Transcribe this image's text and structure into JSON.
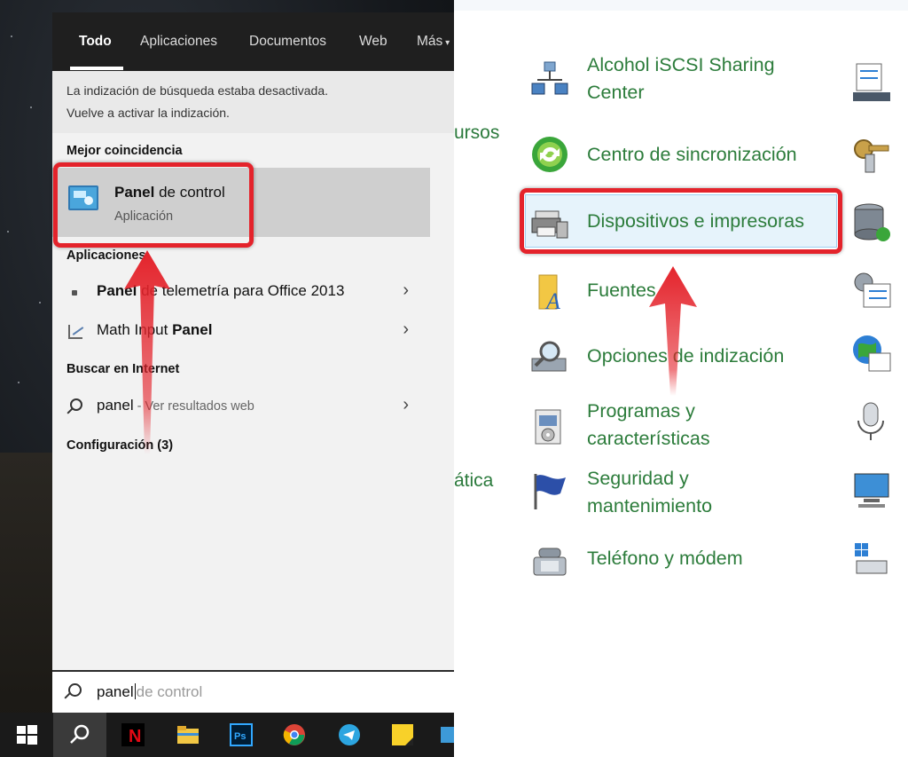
{
  "start_search": {
    "tabs": [
      "Todo",
      "Aplicaciones",
      "Documentos",
      "Web",
      "Más"
    ],
    "notice": {
      "line1": "La indización de búsqueda estaba desactivada.",
      "line2": "Vuelve a activar la indización."
    },
    "best_match_header": "Mejor coincidencia",
    "best_match": {
      "title_bold": "Panel",
      "title_rest": " de control",
      "subtitle": "Aplicación"
    },
    "apps_header": "Aplicaciones",
    "apps": [
      {
        "bold": "Panel",
        "rest": " de telemetría para Office 2013"
      },
      {
        "pre": "Math Input ",
        "bold": "Panel"
      }
    ],
    "web_header": "Buscar en Internet",
    "web_item": {
      "query": "panel",
      "suffix": " - Ver resultados web"
    },
    "settings_header": "Configuración (3)",
    "search_box": {
      "typed": "panel",
      "ghost": "de control"
    }
  },
  "taskbar": {
    "items": [
      "start-icon",
      "search-icon",
      "netflix-icon",
      "file-explorer-icon",
      "photoshop-icon",
      "chrome-icon",
      "telegram-icon",
      "sticky-notes-icon",
      "app-icon"
    ]
  },
  "control_panel": {
    "partial_left": [
      "ursos",
      "ática"
    ],
    "items": [
      {
        "label": "Alcohol iSCSI Sharing\nCenter",
        "icon": "network-icon"
      },
      {
        "label": "Centro de sincronización",
        "icon": "sync-icon"
      },
      {
        "label": "Dispositivos e impresoras",
        "icon": "printer-icon"
      },
      {
        "label": "Fuentes",
        "icon": "fonts-icon"
      },
      {
        "label": "Opciones de indización",
        "icon": "indexing-icon"
      },
      {
        "label": "Programas y\ncaracterísticas",
        "icon": "programs-icon"
      },
      {
        "label": "Seguridad y\nmantenimiento",
        "icon": "flag-icon"
      },
      {
        "label": "Teléfono y módem",
        "icon": "phone-icon"
      }
    ]
  },
  "colors": {
    "highlight_red": "#e4232b",
    "cp_link_green": "#2c7c3b",
    "tab_bar": "#1f1f1f"
  }
}
